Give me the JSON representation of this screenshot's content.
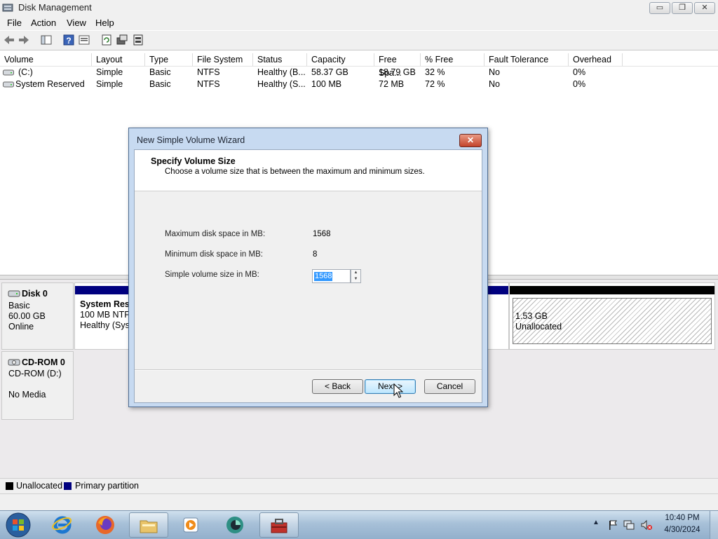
{
  "window": {
    "title": "Disk Management",
    "controls": {
      "minimize": "▭",
      "maximize": "❐",
      "close": "✕"
    }
  },
  "menu": [
    "File",
    "Action",
    "View",
    "Help"
  ],
  "toolbar_icons": [
    "back-arrow-icon",
    "forward-arrow-icon",
    "console-tree-icon",
    "help-icon",
    "properties-icon",
    "refresh-icon",
    "rescan-icon",
    "disk-properties-icon"
  ],
  "volume_table": {
    "columns": [
      "Volume",
      "Layout",
      "Type",
      "File System",
      "Status",
      "Capacity",
      "Free Spa...",
      "% Free",
      "Fault Tolerance",
      "Overhead"
    ],
    "rows": [
      [
        "(C:)",
        "Simple",
        "Basic",
        "NTFS",
        "Healthy (B...",
        "58.37 GB",
        "18.79 GB",
        "32 %",
        "No",
        "0%"
      ],
      [
        "System Reserved",
        "Simple",
        "Basic",
        "NTFS",
        "Healthy (S...",
        "100 MB",
        "72 MB",
        "72 %",
        "No",
        "0%"
      ]
    ]
  },
  "disks": {
    "disk0": {
      "name": "Disk 0",
      "type": "Basic",
      "size": "60.00 GB",
      "state": "Online",
      "partition_name": "System Rese",
      "partition_fs": "100 MB NTFS",
      "partition_status": "Healthy (Syst",
      "unalloc_size": "1.53 GB",
      "unalloc_label": "Unallocated"
    },
    "cdrom0": {
      "name": "CD-ROM 0",
      "drive": "CD-ROM (D:)",
      "media": "No Media"
    }
  },
  "legend": {
    "unallocated": "Unallocated",
    "primary": "Primary partition",
    "unallocated_color": "#000000",
    "primary_color": "#00007f"
  },
  "wizard": {
    "title": "New Simple Volume Wizard",
    "close": "✕",
    "heading": "Specify Volume Size",
    "subheading": "Choose a volume size that is between the maximum and minimum sizes.",
    "max_label": "Maximum disk space in MB:",
    "max_value": "1568",
    "min_label": "Minimum disk space in MB:",
    "min_value": "8",
    "size_label": "Simple volume size in MB:",
    "size_value": "1568",
    "back": "< Back",
    "next": "Next >",
    "cancel": "Cancel"
  },
  "taskbar": {
    "items": [
      "start-orb",
      "internet-explorer",
      "firefox",
      "windows-explorer",
      "media-player",
      "app-icon",
      "computer-management"
    ],
    "clock_time": "10:40 PM",
    "clock_date": "4/30/2024"
  }
}
